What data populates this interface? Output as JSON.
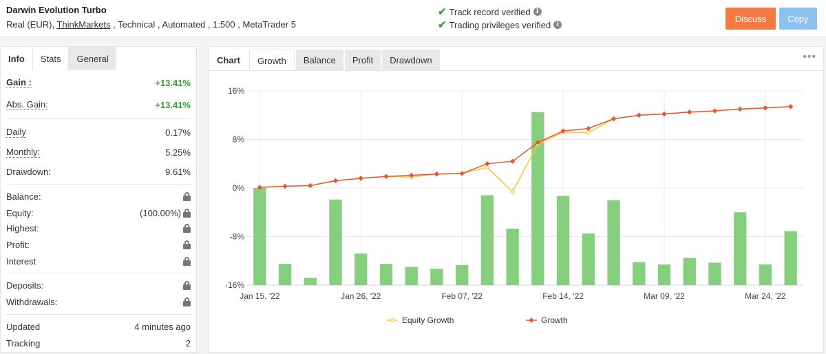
{
  "header": {
    "system_name": "Darwin Evolution Turbo",
    "info_prefix": "Real (EUR), ",
    "broker": "ThinkMarkets",
    "info_suffix": " , Technical , Automated , 1:500 , MetaTrader 5",
    "verified_track": "Track record verified",
    "verified_trading": "Trading privileges verified",
    "discuss_label": "Discuss",
    "copy_label": "Copy"
  },
  "left_tabs": [
    "Info",
    "Stats",
    "General"
  ],
  "stats": {
    "gain_label": "Gain :",
    "gain_value": "+13.41%",
    "abs_gain_label": "Abs. Gain:",
    "abs_gain_value": "+13.41%",
    "daily_label": "Daily",
    "daily_value": "0.17%",
    "monthly_label": "Monthly:",
    "monthly_value": "5.25%",
    "drawdown_label": "Drawdown:",
    "drawdown_value": "9.61%",
    "balance_label": "Balance:",
    "equity_label": "Equity:",
    "equity_value": "(100.00%)",
    "highest_label": "Highest:",
    "profit_label": "Profit:",
    "interest_label": "Interest",
    "deposits_label": "Deposits:",
    "withdrawals_label": "Withdrawals:",
    "updated_label": "Updated",
    "updated_value": "4 minutes ago",
    "tracking_label": "Tracking",
    "tracking_value": "2"
  },
  "chart_tabs": {
    "label": "Chart",
    "tabs": [
      "Growth",
      "Balance",
      "Profit",
      "Drawdown"
    ],
    "active": "Growth"
  },
  "chart_data": {
    "type": "bar",
    "title": "",
    "xlabel": "",
    "ylabel": "",
    "ylim": [
      -16,
      16
    ],
    "y_ticks": [
      "16%",
      "8%",
      "0%",
      "-8%",
      "-16%"
    ],
    "x_tick_labels": [
      "Jan 15, '22",
      "Jan 26, '22",
      "Feb 07, '22",
      "Feb 14, '22",
      "Mar 09, '22",
      "Mar 24, '22"
    ],
    "x_tick_index": [
      0,
      4,
      8,
      12,
      16,
      20
    ],
    "bars": [
      0,
      -12.5,
      -14.8,
      -1.9,
      -10.8,
      -12.5,
      -13.0,
      -13.3,
      -12.7,
      -1.2,
      -6.7,
      12.5,
      -1.3,
      -7.5,
      -2.0,
      -12.2,
      -12.6,
      -11.5,
      -12.3,
      -4.0,
      -12.6,
      -7.1
    ],
    "series": [
      {
        "name": "Equity Growth",
        "color": "#f7c631",
        "values": [
          0.1,
          0.3,
          0.4,
          1.2,
          1.6,
          1.9,
          1.8,
          2.3,
          2.4,
          3.4,
          -0.6,
          7.2,
          9.2,
          9.1,
          11.4,
          12.0,
          12.2,
          12.5,
          12.7,
          13.0,
          13.2,
          13.41
        ]
      },
      {
        "name": "Growth",
        "color": "#e75735",
        "values": [
          0.1,
          0.3,
          0.4,
          1.2,
          1.6,
          1.9,
          2.1,
          2.3,
          2.4,
          4.0,
          4.4,
          7.5,
          9.4,
          9.8,
          11.4,
          12.0,
          12.2,
          12.5,
          12.7,
          13.0,
          13.2,
          13.41
        ]
      }
    ],
    "legend_position": "bottom",
    "colors": {
      "bar": "#86cf7e",
      "grid": "#e8e8e8"
    }
  }
}
